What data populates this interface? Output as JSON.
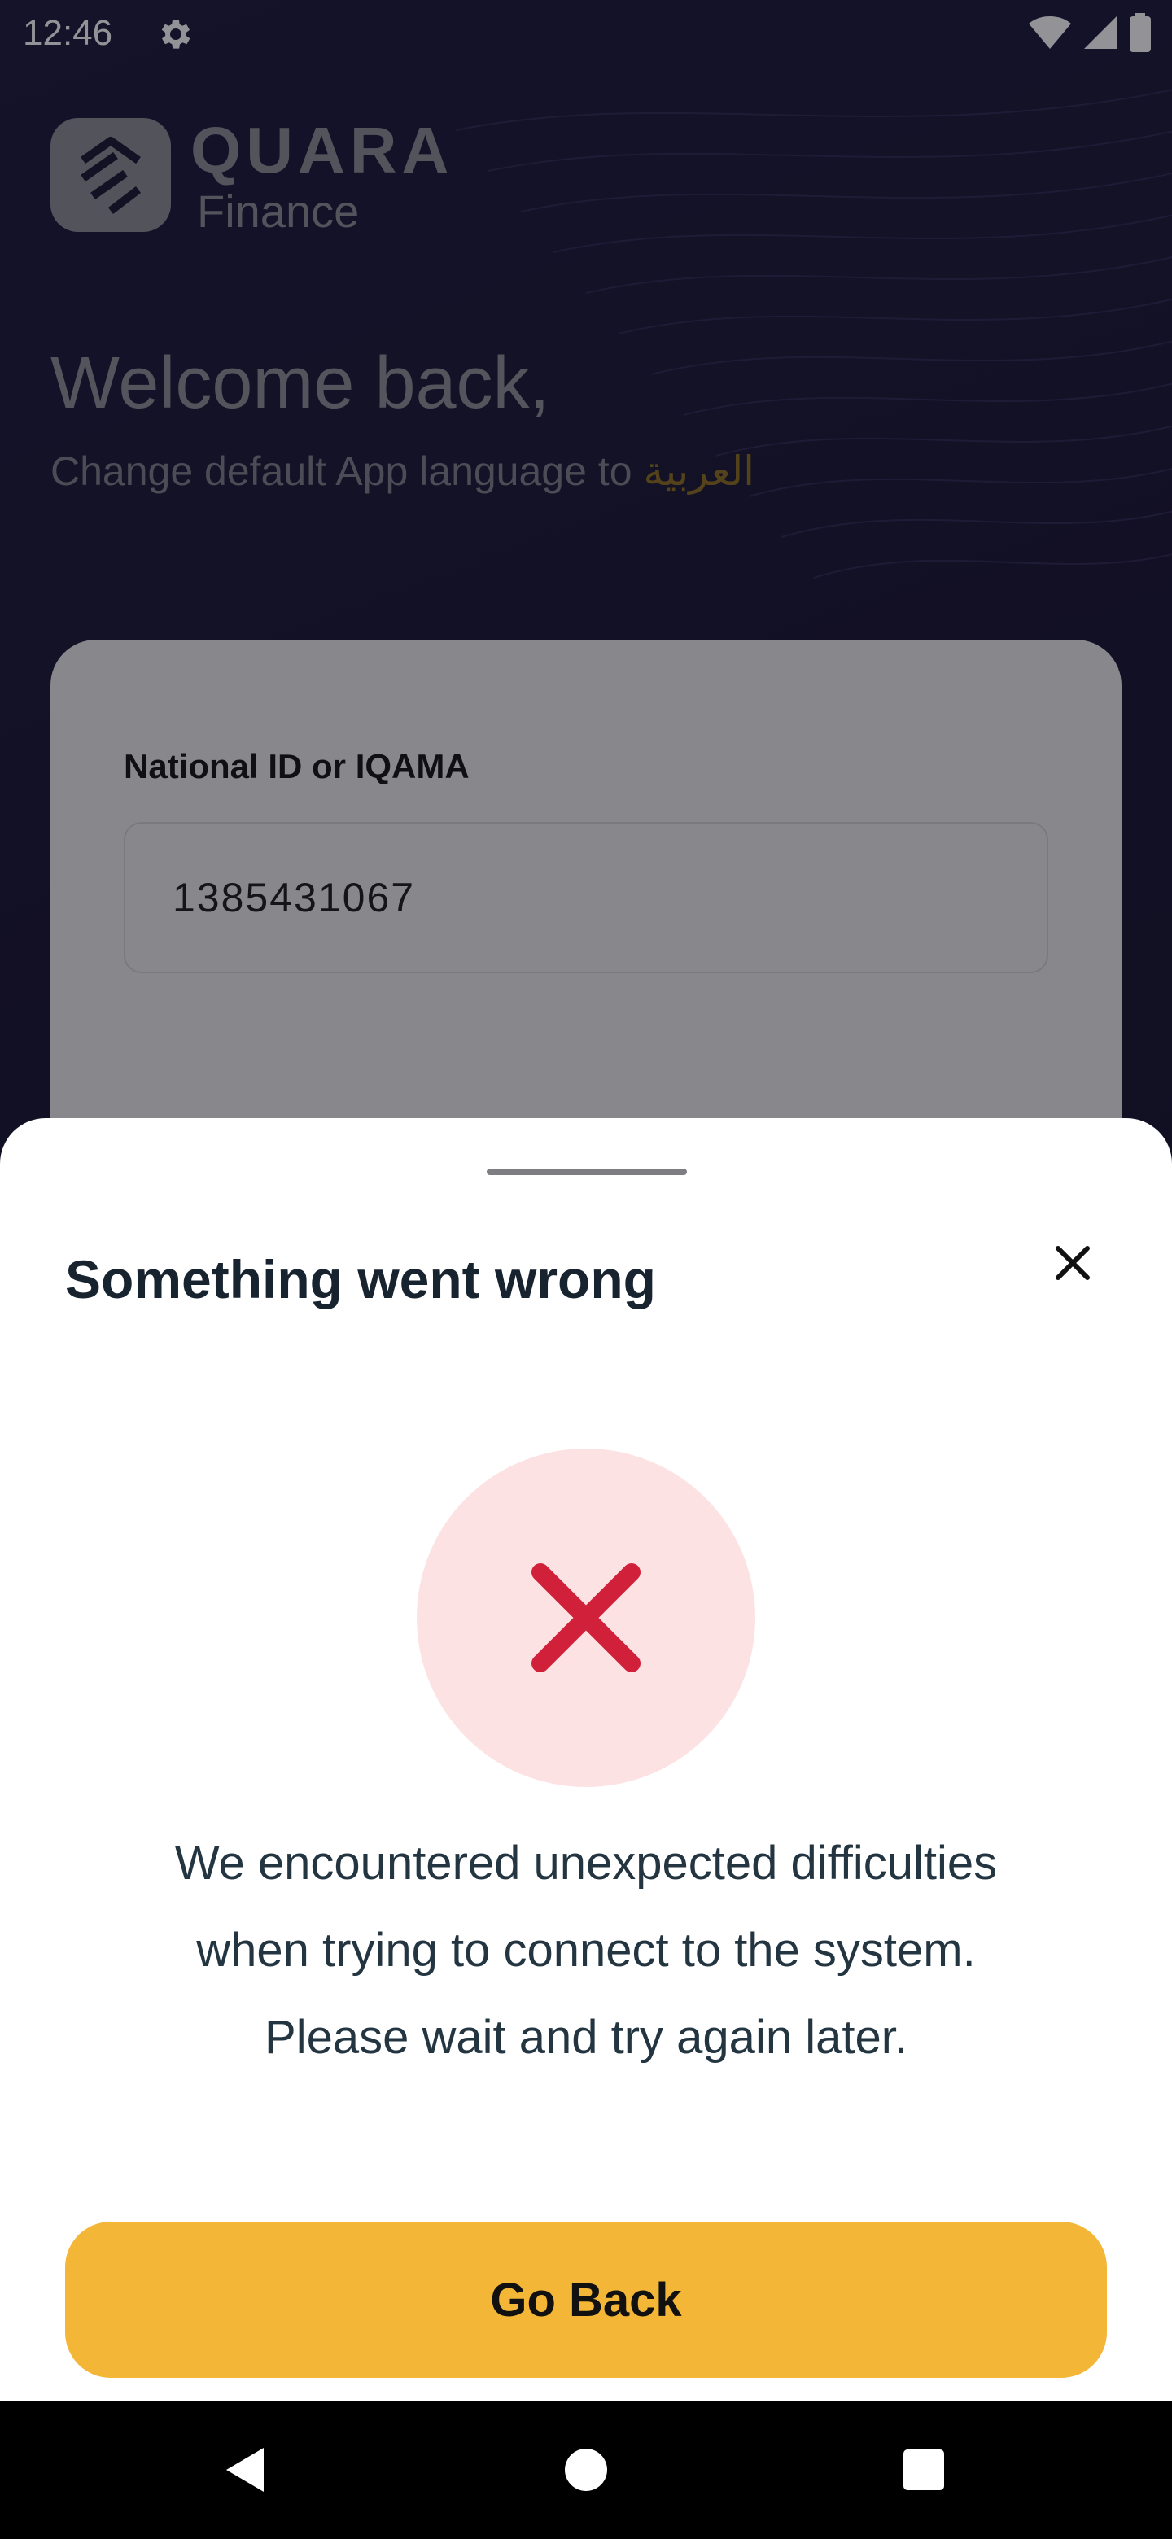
{
  "status_bar": {
    "time": "12:46",
    "icons": [
      "settings-icon",
      "wifi-icon",
      "cellular-signal-icon",
      "battery-icon"
    ]
  },
  "brand": {
    "name": "QUARA",
    "subtitle": "Finance"
  },
  "welcome": {
    "title": "Welcome back,",
    "language_prompt": "Change default App language to",
    "language_link": "العربية"
  },
  "login_form": {
    "id_label": "National ID or IQAMA",
    "id_value": "1385431067"
  },
  "error_sheet": {
    "title": "Something went wrong",
    "close_icon": "close-icon",
    "status_icon": "error-x-icon",
    "message_lines": [
      "We encountered unexpected difficulties",
      "when trying to connect to the system.",
      "Please wait and try again later."
    ],
    "button_label": "Go Back"
  },
  "nav_bar": {
    "buttons": [
      "back-icon",
      "home-icon",
      "recents-icon"
    ]
  },
  "colors": {
    "background": "#13102b",
    "accent": "#f3b636",
    "error": "#d0203a",
    "error_bg": "#fde2e3",
    "link": "#8d6c1c"
  }
}
